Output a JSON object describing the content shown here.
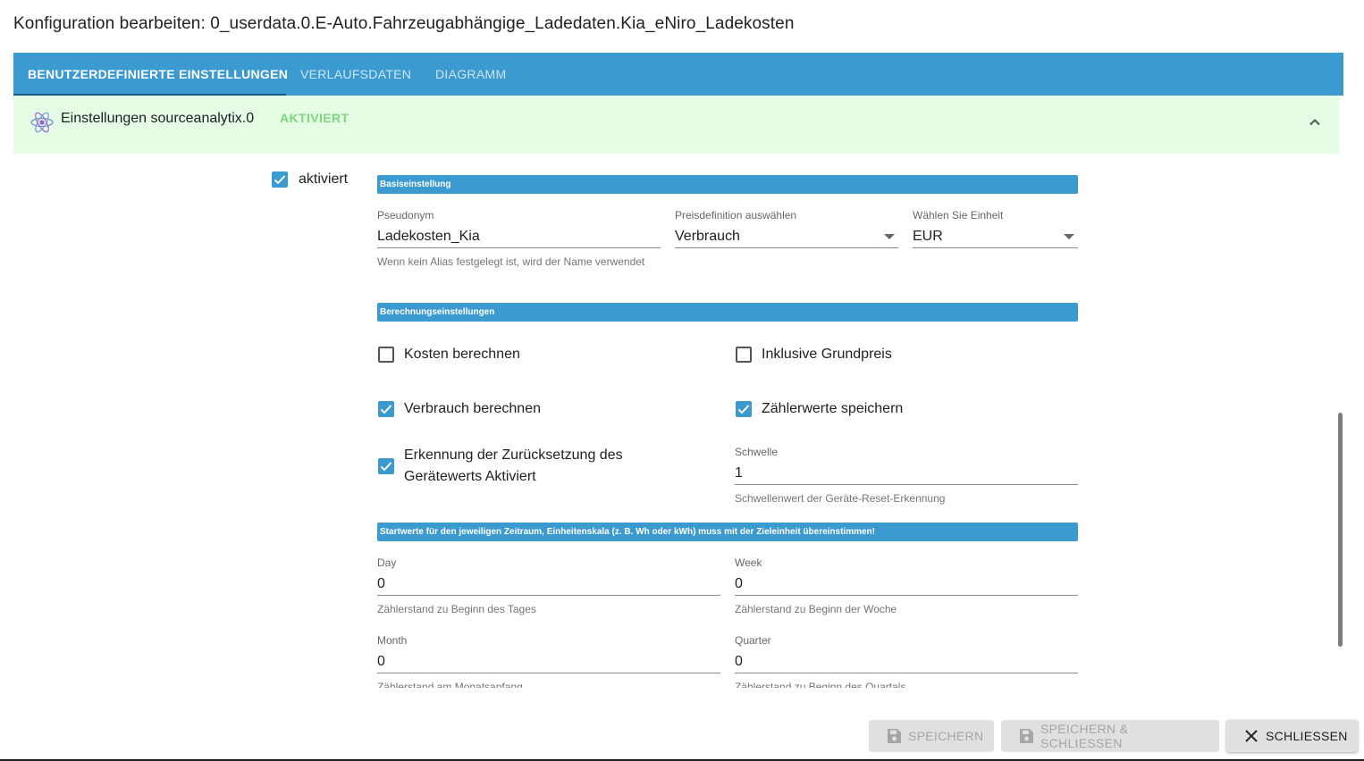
{
  "dialog": {
    "title": "Konfiguration bearbeiten: 0_userdata.0.E-Auto.Fahrzeugabhängige_Ladedaten.Kia_eNiro_Ladekosten"
  },
  "tabs": [
    {
      "label": "BENUTZERDEFINIERTE EINSTELLUNGEN",
      "active": true
    },
    {
      "label": "VERLAUFSDATEN",
      "active": false
    },
    {
      "label": "DIAGRAMM",
      "active": false
    }
  ],
  "accordion": {
    "title": "Einstellungen sourceanalytix.0",
    "status": "AKTIVIERT",
    "icon": "atom-icon",
    "expanded": true
  },
  "enabled": {
    "label": "aktiviert",
    "checked": true
  },
  "sections": {
    "basic": "Basiseinstellung",
    "calc": "Berechnungseinstellungen",
    "start": "Startwerte für den jeweiligen Zeitraum, Einheitenskala (z. B. Wh oder kWh) muss mit der Zieleinheit übereinstimmen!"
  },
  "fields": {
    "alias": {
      "label": "Pseudonym",
      "value": "Ladekosten_Kia",
      "help": "Wenn kein Alias festgelegt ist, wird der Name verwendet"
    },
    "price_def": {
      "label": "Preisdefinition auswählen",
      "value": "Verbrauch"
    },
    "unit": {
      "label": "Wählen Sie Einheit",
      "value": "EUR"
    },
    "threshold": {
      "label": "Schwelle",
      "value": "1",
      "help": "Schwellenwert der Geräte-Reset-Erkennung"
    },
    "day": {
      "label": "Day",
      "value": "0",
      "help": "Zählerstand zu Beginn des Tages"
    },
    "week": {
      "label": "Week",
      "value": "0",
      "help": "Zählerstand zu Beginn der Woche"
    },
    "month": {
      "label": "Month",
      "value": "0",
      "help": "Zählerstand am Monatsanfang"
    },
    "quarter": {
      "label": "Quarter",
      "value": "0",
      "help": "Zählerstand zu Beginn des Quartals"
    }
  },
  "checkboxes": {
    "costs": {
      "label": "Kosten berechnen",
      "checked": false
    },
    "base_price": {
      "label": "Inklusive Grundpreis",
      "checked": false
    },
    "consumption": {
      "label": "Verbrauch berechnen",
      "checked": true
    },
    "save_counter": {
      "label": "Zählerwerte speichern",
      "checked": true
    },
    "reset_detect": {
      "label": "Erkennung der Zurücksetzung des Gerätewerts Aktiviert",
      "checked": true
    }
  },
  "buttons": {
    "save": "SPEICHERN",
    "save_close": "SPEICHERN & SCHLIESSEN",
    "close": "SCHLIESSEN"
  },
  "colors": {
    "accent": "#3b9ad0",
    "accordion_bg": "#e5fde5",
    "status_green": "#7ed77e"
  }
}
